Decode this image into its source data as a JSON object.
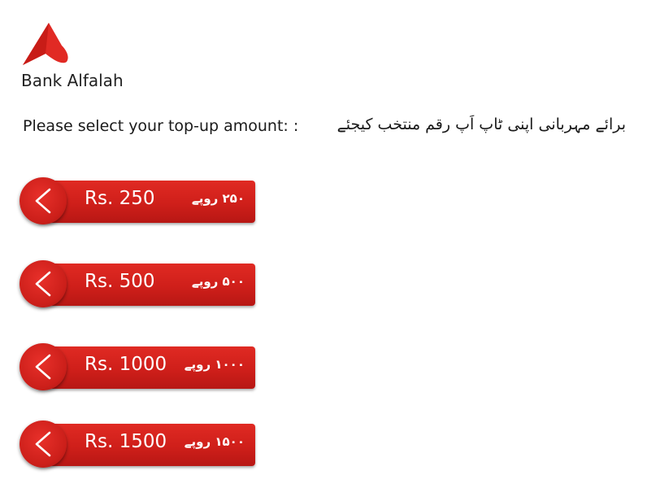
{
  "brand": {
    "name": "Bank Alfalah",
    "accent_color": "#d7261f",
    "logo_icon": "bank-alfalah-logo-icon"
  },
  "prompt": {
    "english": "Please select your top-up amount: :",
    "urdu": "برائے مہربانی اپنی ٹاپ اَپ رقم منتخب کیجئے"
  },
  "amounts": [
    {
      "label": "Rs. 250",
      "urdu_label": "۲۵۰ روپے",
      "icon": "chevron-left-icon"
    },
    {
      "label": "Rs. 500",
      "urdu_label": "۵۰۰ روپے",
      "icon": "chevron-left-icon"
    },
    {
      "label": "Rs. 1000",
      "urdu_label": "۱۰۰۰ روپے",
      "icon": "chevron-left-icon"
    },
    {
      "label": "Rs. 1500",
      "urdu_label": "۱۵۰۰ روپے",
      "icon": "chevron-left-icon"
    }
  ]
}
